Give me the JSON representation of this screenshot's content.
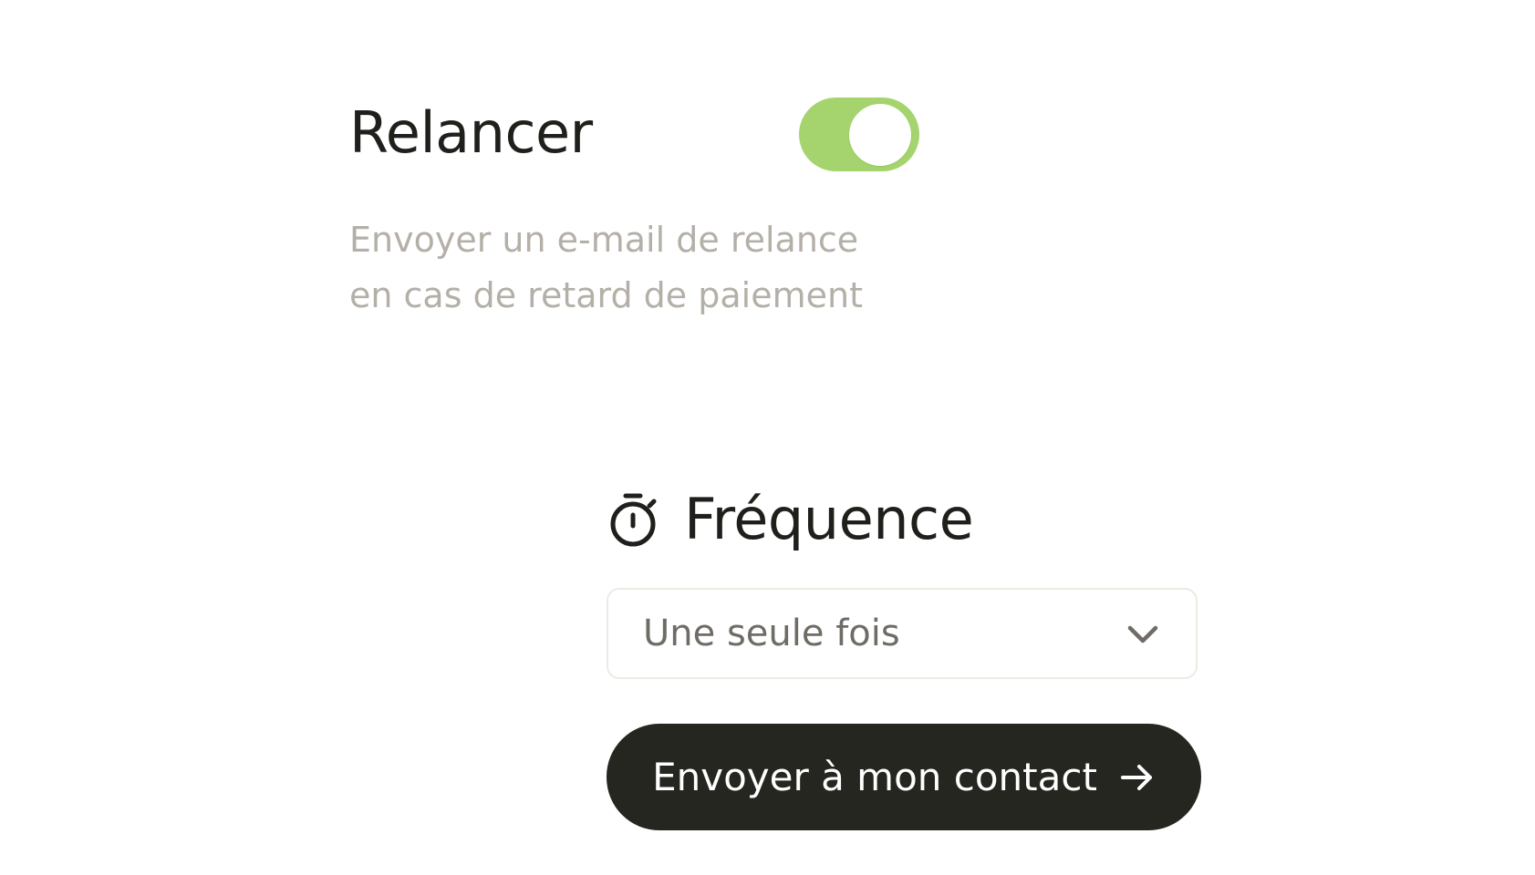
{
  "reminder": {
    "title": "Relancer",
    "toggle": {
      "state": "on",
      "color": "#a5d46e"
    },
    "description_lines": [
      "Envoyer un e-mail de relance",
      "en cas de retard de paiement"
    ]
  },
  "frequency": {
    "icon": "timer-icon",
    "title": "Fréquence",
    "select": {
      "selected_value": "Une seule fois",
      "icon": "chevron-down-icon"
    }
  },
  "send_button": {
    "label": "Envoyer à mon contact",
    "icon": "arrow-right-icon",
    "background": "#262621"
  }
}
